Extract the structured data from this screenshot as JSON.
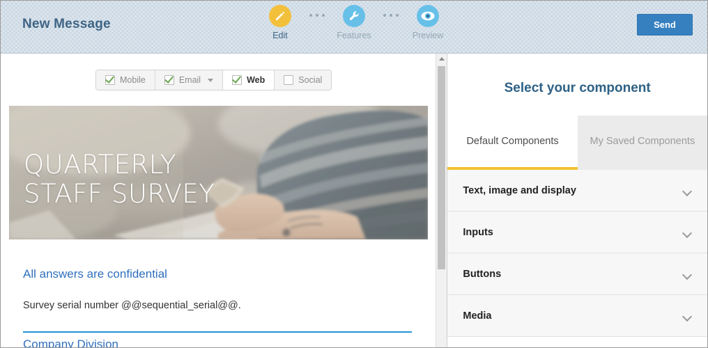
{
  "header": {
    "title": "New Message",
    "send_label": "Send",
    "steps": [
      {
        "label": "Edit",
        "icon": "pencil-icon",
        "color": "#f3c03c",
        "state": "active"
      },
      {
        "label": "Features",
        "icon": "wrench-icon",
        "color": "#67c0e8",
        "state": "inactive"
      },
      {
        "label": "Preview",
        "icon": "eye-icon",
        "color": "#67c0e8",
        "state": "inactive"
      }
    ],
    "separator_icon": "ellipsis-icon"
  },
  "editor": {
    "channels": [
      {
        "label": "Mobile",
        "checked": true,
        "active": false,
        "has_dropdown": false
      },
      {
        "label": "Email",
        "checked": true,
        "active": false,
        "has_dropdown": true
      },
      {
        "label": "Web",
        "checked": true,
        "active": true,
        "has_dropdown": false
      },
      {
        "label": "Social",
        "checked": false,
        "active": false,
        "has_dropdown": false
      }
    ],
    "hero": {
      "title": "QUARTERLY\nSTAFF SURVEY",
      "alt": "photo of a person in a striped sweater holding a mobile phone at a desk"
    },
    "lead_heading": "All answers are confidential",
    "body_copy": "Survey serial number @@sequential_serial@@.",
    "section_heading": "Company Division",
    "divider_color": "#2196d6"
  },
  "scrollbar": {
    "up_arrow_icon": "triangle-up-icon",
    "thumb_label": "scroll-thumb"
  },
  "component_panel": {
    "title": "Select your component",
    "tabs": [
      {
        "label": "Default Components",
        "active": true
      },
      {
        "label": "My Saved Components",
        "active": false
      }
    ],
    "accent_color": "#f2c230",
    "groups": [
      {
        "label": "Text, image and display",
        "icon": "chevron-down-icon"
      },
      {
        "label": "Inputs",
        "icon": "chevron-down-icon"
      },
      {
        "label": "Buttons",
        "icon": "chevron-down-icon"
      },
      {
        "label": "Media",
        "icon": "chevron-down-icon"
      }
    ]
  }
}
